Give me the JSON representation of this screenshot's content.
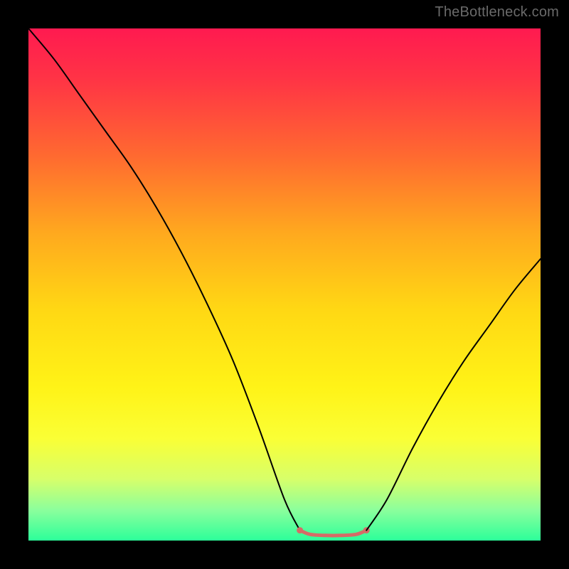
{
  "watermark": "TheBottleneck.com",
  "chart_data": {
    "type": "line",
    "title": "",
    "xlabel": "",
    "ylabel": "",
    "xlim": [
      0,
      100
    ],
    "ylim": [
      0,
      100
    ],
    "legend": false,
    "background_gradient": {
      "type": "vertical",
      "stops": [
        {
          "offset": 0.0,
          "color": "#ff1a50"
        },
        {
          "offset": 0.1,
          "color": "#ff3445"
        },
        {
          "offset": 0.25,
          "color": "#ff6a30"
        },
        {
          "offset": 0.4,
          "color": "#ffa91e"
        },
        {
          "offset": 0.55,
          "color": "#ffd814"
        },
        {
          "offset": 0.7,
          "color": "#fff317"
        },
        {
          "offset": 0.8,
          "color": "#faff35"
        },
        {
          "offset": 0.88,
          "color": "#d7ff6a"
        },
        {
          "offset": 0.94,
          "color": "#8cff9c"
        },
        {
          "offset": 1.0,
          "color": "#2cff9a"
        }
      ]
    },
    "series": [
      {
        "name": "curve-left",
        "color": "#000000",
        "width": 2,
        "x": [
          0,
          5,
          10,
          15,
          20,
          25,
          30,
          35,
          40,
          45,
          50,
          53
        ],
        "y": [
          100,
          94,
          87,
          80,
          73,
          65,
          56,
          46,
          35,
          22,
          8,
          2
        ]
      },
      {
        "name": "flat-bottom",
        "color": "#d66b67",
        "width": 5,
        "x": [
          53,
          55,
          58,
          61,
          64,
          66
        ],
        "y": [
          2,
          1.2,
          1,
          1,
          1.2,
          2
        ]
      },
      {
        "name": "curve-right",
        "color": "#000000",
        "width": 2,
        "x": [
          66,
          70,
          75,
          80,
          85,
          90,
          95,
          100
        ],
        "y": [
          2,
          8,
          18,
          27,
          35,
          42,
          49,
          55
        ]
      }
    ],
    "annotations": []
  }
}
